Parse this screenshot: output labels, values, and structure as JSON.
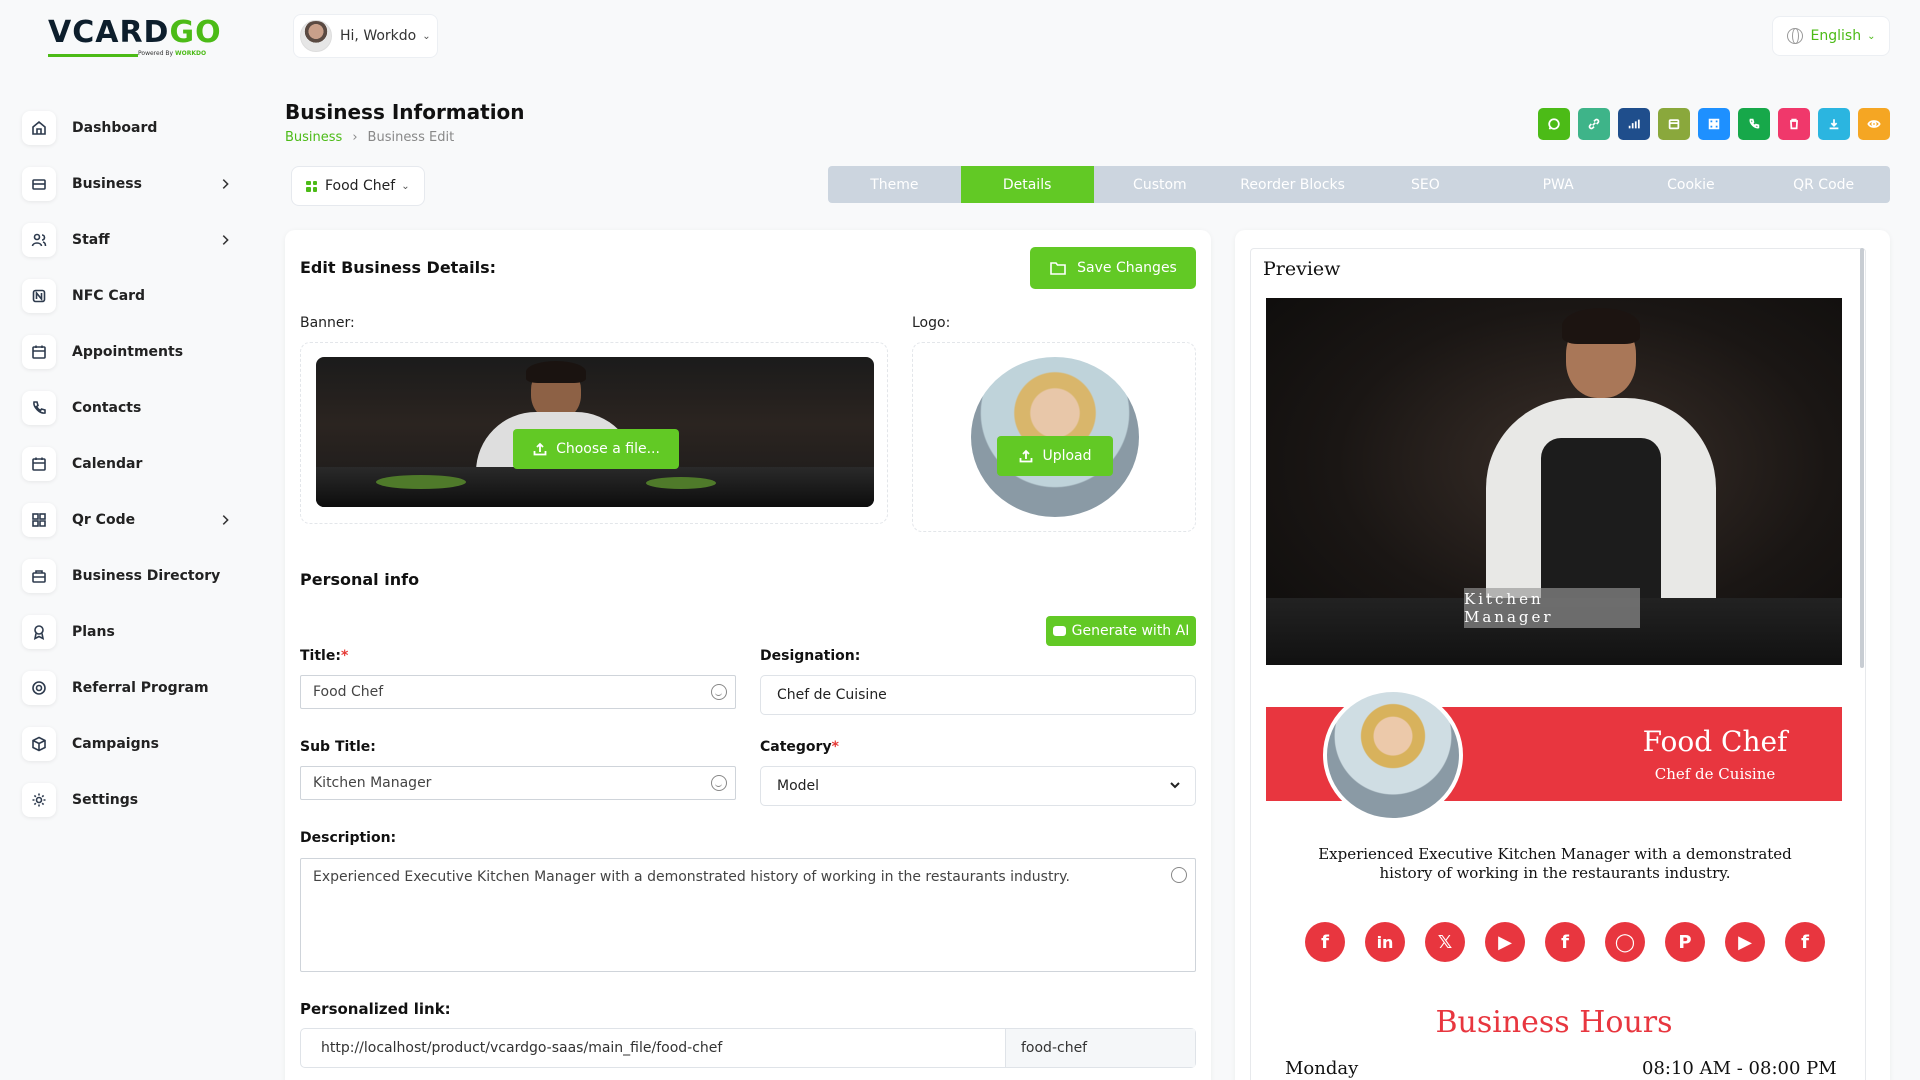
{
  "brand": {
    "logo_main": "VCARDGO",
    "powered_by": "Powered By WORKDO"
  },
  "sidebar": {
    "items": [
      {
        "label": "Dashboard",
        "icon": "home-icon",
        "has_children": false
      },
      {
        "label": "Business",
        "icon": "briefcase-icon",
        "has_children": true
      },
      {
        "label": "Staff",
        "icon": "users-icon",
        "has_children": true
      },
      {
        "label": "NFC Card",
        "icon": "nfc-icon",
        "has_children": false
      },
      {
        "label": "Appointments",
        "icon": "calendar-icon",
        "has_children": false
      },
      {
        "label": "Contacts",
        "icon": "phone-icon",
        "has_children": false
      },
      {
        "label": "Calendar",
        "icon": "calendar-icon",
        "has_children": false
      },
      {
        "label": "Qr Code",
        "icon": "qrcode-icon",
        "has_children": true
      },
      {
        "label": "Business Directory",
        "icon": "directory-icon",
        "has_children": false
      },
      {
        "label": "Plans",
        "icon": "award-icon",
        "has_children": false
      },
      {
        "label": "Referral Program",
        "icon": "referral-icon",
        "has_children": false
      },
      {
        "label": "Campaigns",
        "icon": "box-icon",
        "has_children": false
      },
      {
        "label": "Settings",
        "icon": "gear-icon",
        "has_children": false
      }
    ]
  },
  "header": {
    "greeting": "Hi, Workdo",
    "language": "English"
  },
  "page": {
    "title": "Business Information",
    "breadcrumb": {
      "link": "Business",
      "current": "Business Edit"
    },
    "business_select": "Food Chef",
    "tabs": [
      "Theme",
      "Details",
      "Custom",
      "Reorder Blocks",
      "SEO",
      "PWA",
      "Cookie",
      "QR Code"
    ],
    "active_tab": "Details",
    "quick_actions": [
      {
        "icon": "whatsapp-icon",
        "color": "#4cbb17"
      },
      {
        "icon": "link-icon",
        "color": "#3eb489"
      },
      {
        "icon": "analytics-icon",
        "color": "#1f4e8c"
      },
      {
        "icon": "calendar-icon",
        "color": "#8aa83c"
      },
      {
        "icon": "grid-icon",
        "color": "#1e90ff"
      },
      {
        "icon": "phone-icon",
        "color": "#17a84a"
      },
      {
        "icon": "trash-icon",
        "color": "#f0386b"
      },
      {
        "icon": "download-icon",
        "color": "#2bb5e0"
      },
      {
        "icon": "eye-icon",
        "color": "#f5a623"
      }
    ]
  },
  "edit": {
    "section_title": "Edit Business Details:",
    "save_label": "Save Changes",
    "banner_label": "Banner:",
    "choose_file": "Choose a file...",
    "logo_label": "Logo:",
    "upload_label": "Upload",
    "personal_info": "Personal info",
    "generate_ai": "Generate with AI",
    "title_label": "Title:",
    "title_value": "Food Chef",
    "designation_label": "Designation:",
    "designation_value": "Chef de Cuisine",
    "subtitle_label": "Sub Title:",
    "subtitle_value": "Kitchen Manager",
    "category_label": "Category",
    "category_value": "Model",
    "description_label": "Description:",
    "description_value": "Experienced Executive Kitchen Manager with a demonstrated history of working in the restaurants industry.",
    "link_label": "Personalized link:",
    "link_url": "http://localhost/product/vcardgo-saas/main_file/food-chef",
    "link_slug": "food-chef"
  },
  "preview": {
    "title": "Preview",
    "badge": "Kitchen Manager",
    "name": "Food Chef",
    "designation": "Chef de Cuisine",
    "description": "Experienced Executive Kitchen Manager with a demonstrated history of working in the restaurants industry.",
    "socials": [
      "f",
      "in",
      "X",
      "yt",
      "f",
      "ig",
      "p",
      "yt",
      "f"
    ],
    "hours_title": "Business Hours",
    "first_day": "Monday",
    "first_time": "08:10 AM - 08:00 PM",
    "accent": "#e8363f"
  }
}
